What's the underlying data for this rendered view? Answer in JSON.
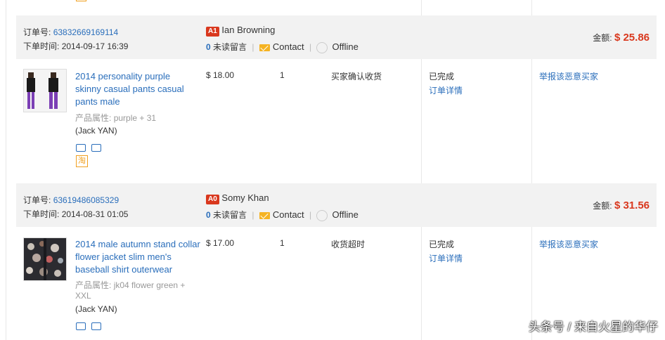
{
  "orders": [
    {
      "order_no_label": "订单号:",
      "order_no": "63832669169114",
      "time_label": "下单时间:",
      "time": "2014-09-17 16:39",
      "buyer_tag": "A1",
      "buyer_name": "Ian Browning",
      "unread_count": "0",
      "unread_label": "未读留言",
      "contact_label": "Contact",
      "status_label": "Offline",
      "amount_label": "金额:",
      "amount": "$ 25.86",
      "item": {
        "title": "2014 personality purple skinny casual pants casual pants male",
        "attr_label": "产品属性:",
        "attr_value": "purple + 31",
        "seller": "(Jack YAN)",
        "tao": "淘",
        "price": "$ 18.00",
        "qty": "1",
        "trade_status": "买家确认收货",
        "order_status": "已完成",
        "detail_link": "订单详情",
        "report_link": "举报该恶意买家"
      }
    },
    {
      "order_no_label": "订单号:",
      "order_no": "63619486085329",
      "time_label": "下单时间:",
      "time": "2014-08-31 01:05",
      "buyer_tag": "A0",
      "buyer_name": "Somy Khan",
      "unread_count": "0",
      "unread_label": "未读留言",
      "contact_label": "Contact",
      "status_label": "Offline",
      "amount_label": "金额:",
      "amount": "$ 31.56",
      "item": {
        "title": "2014 male autumn stand collar flower jacket slim men's baseball shirt outerwear",
        "attr_label": "产品属性:",
        "attr_value": "jk04 flower green + XXL",
        "seller": "(Jack YAN)",
        "price": "$ 17.00",
        "qty": "1",
        "trade_status": "收货超时",
        "order_status": "已完成",
        "detail_link": "订单详情",
        "report_link": "举报该恶意买家"
      }
    }
  ],
  "watermark": "头条号 / 来自火星的华仔"
}
